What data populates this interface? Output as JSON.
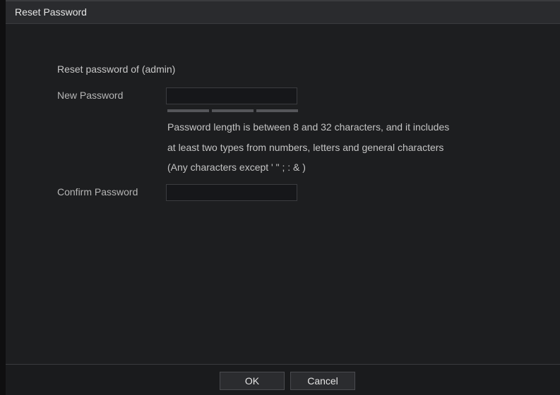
{
  "dialog": {
    "title": "Reset Password"
  },
  "form": {
    "reset_label": "Reset password of (admin)",
    "new_password_label": "New Password",
    "new_password_value": "",
    "strength_segments": 3,
    "hint_lines": [
      "Password length is between 8 and 32 characters, and it includes",
      "at least two types from numbers, letters and general characters",
      "(Any characters except  ' \" ; : & )"
    ],
    "confirm_password_label": "Confirm Password",
    "confirm_password_value": ""
  },
  "footer": {
    "ok_label": "OK",
    "cancel_label": "Cancel"
  },
  "colors": {
    "background": "#1d1e20",
    "titlebar": "#2a2b2e",
    "text": "#b6b6b6"
  }
}
